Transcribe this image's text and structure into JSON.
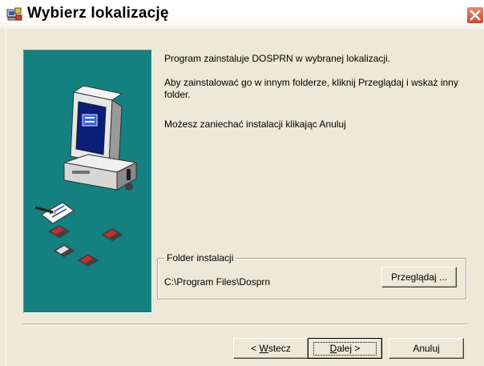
{
  "window": {
    "title": "Wybierz lokalizację",
    "title_icon": "installer-icon",
    "close_icon": "close-icon"
  },
  "side_panel": {
    "illustration": "computer-and-disks-illustration",
    "accent_color": "#148080"
  },
  "messages": [
    "Program zainstaluje DOSPRN w wybranej lokalizacji.",
    "Aby zainstalować go w innym folderze, kliknij Przeglądaj i wskaż inny folder.",
    "Możesz zaniechać instalacji klikając Anuluj"
  ],
  "folder_group": {
    "label": "Folder instalacji",
    "path": "C:\\Program Files\\Dosprn",
    "browse_label": "Przeglądaj ..."
  },
  "buttons": {
    "back_prefix": "< ",
    "back_mnemonic": "W",
    "back_rest": "stecz",
    "next_mnemonic": "D",
    "next_rest": "alej >",
    "cancel_label": "Anuluj"
  }
}
